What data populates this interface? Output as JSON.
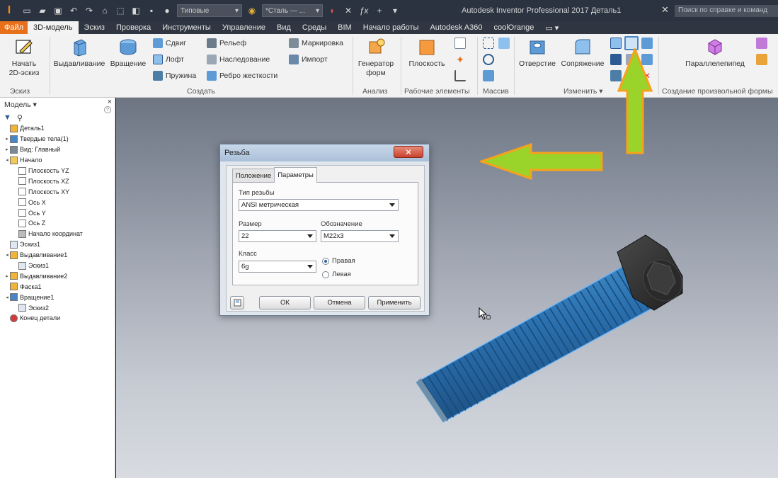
{
  "titlebar": {
    "logo": "I",
    "material_combo": "Типовые",
    "appearance_combo": "*Сталь — ...",
    "app_title": "Autodesk Inventor Professional 2017   Деталь1",
    "help_search": "Поиск по справке и команд"
  },
  "tabs": {
    "file": "Файл",
    "items": [
      "3D-модель",
      "Эскиз",
      "Проверка",
      "Инструменты",
      "Управление",
      "Вид",
      "Среды",
      "BIM",
      "Начало работы",
      "Autodesk A360",
      "coolOrange"
    ]
  },
  "ribbon": {
    "sketch": {
      "start_line1": "Начать",
      "start_line2": "2D-эскиз",
      "panel": "Эскиз"
    },
    "create": {
      "extrude": "Выдавливание",
      "revolve": "Вращение",
      "sweep": "Сдвиг",
      "loft": "Лофт",
      "coil": "Пружина",
      "emboss": "Рельеф",
      "derive": "Наследование",
      "rib": "Ребро жесткости",
      "decal": "Маркировка",
      "import": "Импорт",
      "panel": "Создать"
    },
    "analysis": {
      "shape_gen_line1": "Генератор",
      "shape_gen_line2": "форм",
      "panel": "Анализ"
    },
    "work": {
      "plane": "Плоскость",
      "panel": "Рабочие элементы"
    },
    "pattern": {
      "panel": "Массив"
    },
    "modify": {
      "hole": "Отверстие",
      "fillet": "Сопряжение",
      "panel": "Изменить ▾"
    },
    "freeform": {
      "box": "Параллелепипед",
      "panel": "Создание произвольной формы"
    }
  },
  "browser": {
    "title": "Модель ▾",
    "close": "×",
    "help": "?",
    "items": [
      {
        "label": "Деталь1",
        "indent": 0,
        "exp": "",
        "icon": "part-icon"
      },
      {
        "label": "Твердые тела(1)",
        "indent": 0,
        "exp": "▸",
        "icon": "solid-bodies-icon"
      },
      {
        "label": "Вид: Главный",
        "indent": 0,
        "exp": "▸",
        "icon": "view-icon"
      },
      {
        "label": "Начало",
        "indent": 0,
        "exp": "◂",
        "icon": "origin-folder-icon"
      },
      {
        "label": "Плоскость YZ",
        "indent": 1,
        "exp": "",
        "icon": "plane-icon"
      },
      {
        "label": "Плоскость XZ",
        "indent": 1,
        "exp": "",
        "icon": "plane-icon"
      },
      {
        "label": "Плоскость XY",
        "indent": 1,
        "exp": "",
        "icon": "plane-icon"
      },
      {
        "label": "Ось X",
        "indent": 1,
        "exp": "",
        "icon": "axis-icon"
      },
      {
        "label": "Ось Y",
        "indent": 1,
        "exp": "",
        "icon": "axis-icon"
      },
      {
        "label": "Ось Z",
        "indent": 1,
        "exp": "",
        "icon": "axis-icon"
      },
      {
        "label": "Начало координат",
        "indent": 1,
        "exp": "",
        "icon": "center-point-icon"
      },
      {
        "label": "Эскиз1",
        "indent": 0,
        "exp": "",
        "icon": "sketch-icon"
      },
      {
        "label": "Выдавливание1",
        "indent": 0,
        "exp": "◂",
        "icon": "extrude-icon"
      },
      {
        "label": "Эскиз1",
        "indent": 1,
        "exp": "",
        "icon": "sketch-icon"
      },
      {
        "label": "Выдавливание2",
        "indent": 0,
        "exp": "▸",
        "icon": "extrude-icon"
      },
      {
        "label": "Фаска1",
        "indent": 0,
        "exp": "",
        "icon": "chamfer-icon"
      },
      {
        "label": "Вращение1",
        "indent": 0,
        "exp": "◂",
        "icon": "revolve-icon"
      },
      {
        "label": "Эскиз2",
        "indent": 1,
        "exp": "",
        "icon": "sketch-icon"
      },
      {
        "label": "Конец детали",
        "indent": 0,
        "exp": "",
        "icon": "end-of-part-icon"
      }
    ]
  },
  "dialog": {
    "title": "Резьба",
    "tabs": [
      "Положение",
      "Параметры"
    ],
    "active_tab": "Параметры",
    "thread_type_label": "Тип резьбы",
    "thread_type_value": "ANSI метрическая",
    "size_label": "Размер",
    "size_value": "22",
    "designation_label": "Обозначение",
    "designation_value": "M22x3",
    "class_label": "Класс",
    "class_value": "6g",
    "right_hand": "Правая",
    "left_hand": "Левая",
    "ok": "ОК",
    "cancel": "Отмена",
    "apply": "Применить"
  },
  "colors": {
    "accent_orange": "#e8701b",
    "arrow_fill": "#9ad32a",
    "arrow_stroke": "#f6a21c",
    "bolt_blue": "#2f7fc0",
    "bolt_head": "#2b2b2b"
  }
}
